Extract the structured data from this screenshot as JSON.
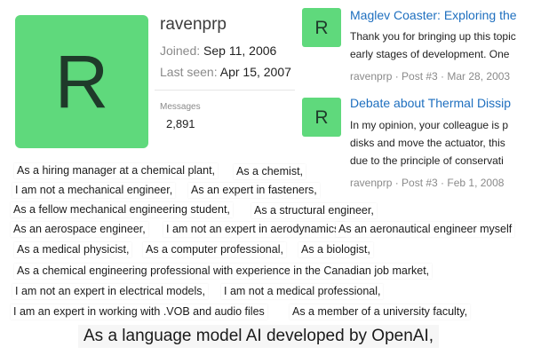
{
  "profile": {
    "avatar_letter": "R",
    "username": "ravenprp",
    "joined_label": "Joined:",
    "joined_value": "Sep 11, 2006",
    "last_seen_label": "Last seen:",
    "last_seen_value": "Apr 15, 2007",
    "messages_label": "Messages",
    "messages_count": "2,891",
    "avatar_color": "#5fd97c"
  },
  "posts": [
    {
      "avatar_letter": "R",
      "title": "Maglev Coaster: Exploring the",
      "body_lines": [
        "Thank you for bringing up this topic",
        "early stages of development. One"
      ],
      "meta": "ravenprp · Post #3 · Mar 28, 2003"
    },
    {
      "avatar_letter": "R",
      "title": "Debate about Thermal Dissip",
      "body_lines": [
        "In my opinion, your colleague is p",
        "disks and move the actuator, this",
        "due to the principle of conservati"
      ],
      "meta": "ravenprp · Post #3 · Feb 1, 2008"
    }
  ],
  "phrases": [
    "As a hiring manager at a chemical plant,",
    "As a chemist,",
    "I am not a mechanical engineer,",
    "As an expert in fasteners,",
    "As a fellow mechanical engineering student,",
    "As a structural engineer,",
    "As an aerospace engineer,",
    "I am not an expert in aerodynamics,",
    "As an aeronautical engineer myself",
    "As a medical physicist,",
    "As a computer professional,",
    "As a biologist,",
    "As a chemical engineering professional with experience in the Canadian job market,",
    "I am not an expert in electrical models,",
    "I am not a medical professional,",
    "I am an expert in working with .VOB and audio files",
    "As a member of a university faculty,"
  ],
  "bottom_line": "As a language model AI developed by OpenAI,",
  "link_color": "#1e6fbf"
}
